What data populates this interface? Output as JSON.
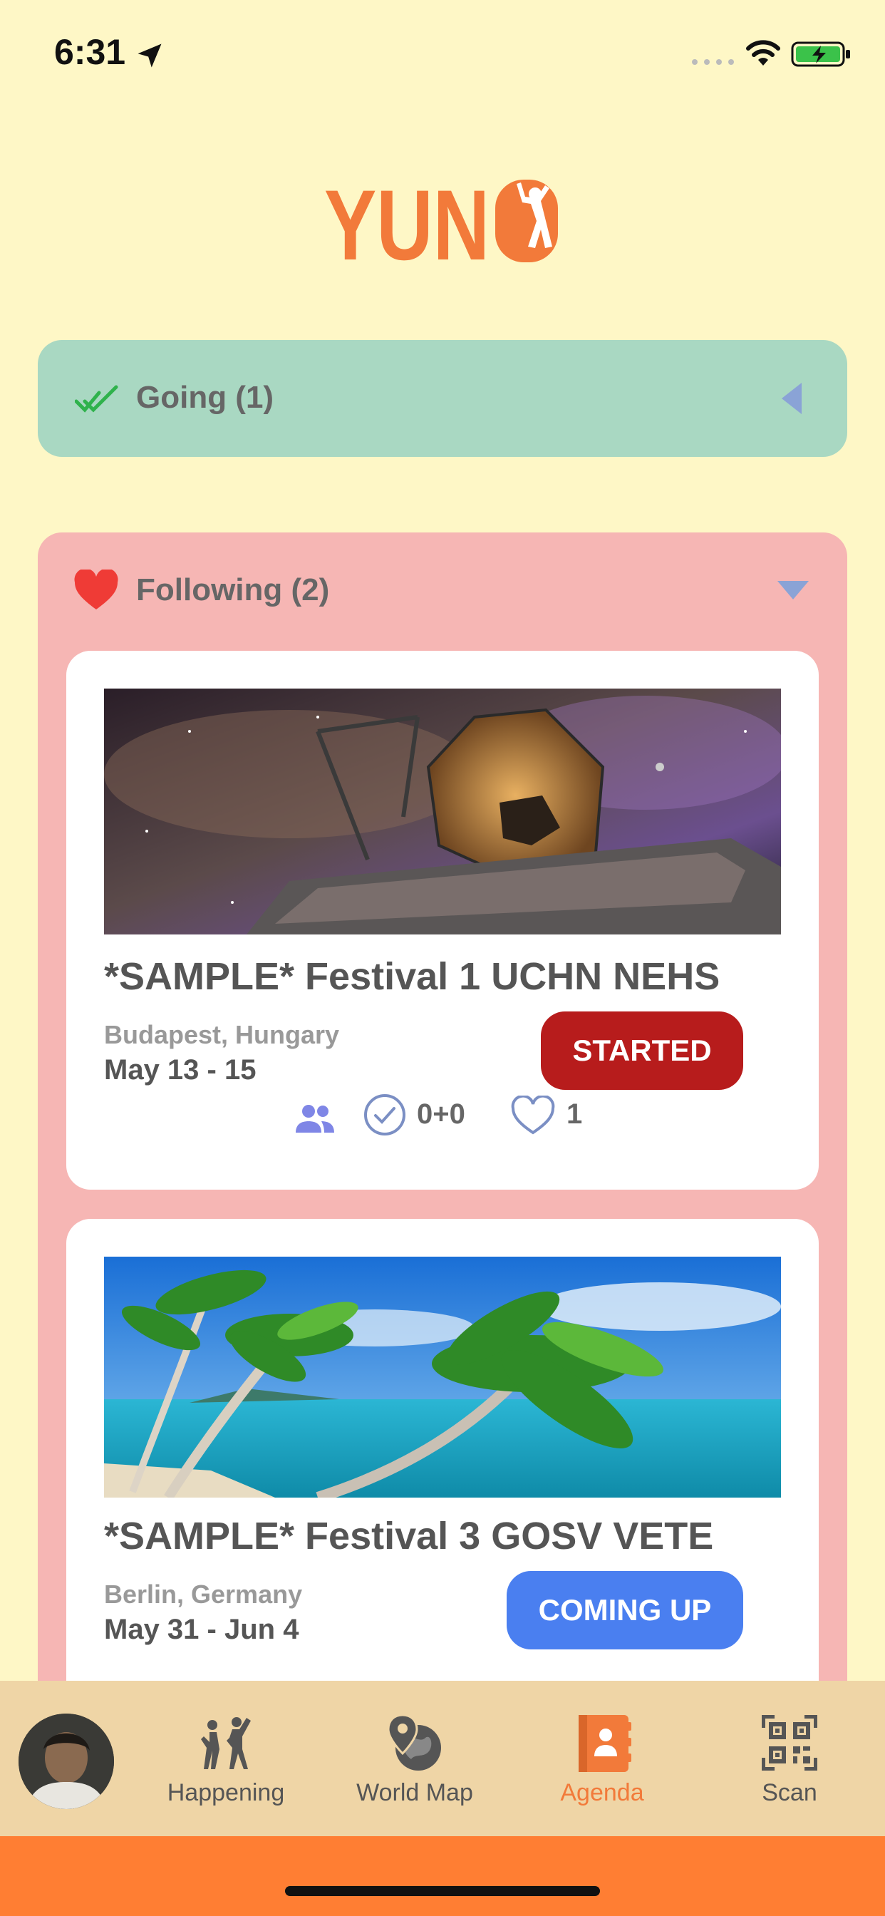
{
  "status_bar": {
    "time": "6:31"
  },
  "app": {
    "logo_text": "YUNO"
  },
  "going": {
    "label": "Going (1)",
    "icon": "double-check-icon"
  },
  "following": {
    "label": "Following (2)",
    "icon": "heart-icon",
    "events": [
      {
        "title": "*SAMPLE* Festival 1 UCHN NEHS",
        "location": "Budapest, Hungary",
        "dates": "May 13 - 15",
        "status": "STARTED",
        "status_color": "#b71c1c",
        "image": "space-telescope-image",
        "check_count": "0+0",
        "like_count": "1"
      },
      {
        "title": "*SAMPLE* Festival 3 GOSV VETE",
        "location": "Berlin, Germany",
        "dates": "May 31 - Jun 4",
        "status": "COMING UP",
        "status_color": "#4a7ff0",
        "image": "tropical-beach-image"
      }
    ]
  },
  "tab_bar": {
    "tabs": [
      {
        "label": "Happening",
        "icon": "dancing-people-icon"
      },
      {
        "label": "World Map",
        "icon": "globe-pin-icon"
      },
      {
        "label": "Agenda",
        "icon": "agenda-book-icon",
        "active": true
      },
      {
        "label": "Scan",
        "icon": "qr-code-icon"
      }
    ]
  },
  "colors": {
    "background": "#fef7c6",
    "going_panel": "#a9d8c2",
    "following_panel": "#f6b6b4",
    "accent": "#f27a3a",
    "tab_bar": "#efd5a6"
  }
}
